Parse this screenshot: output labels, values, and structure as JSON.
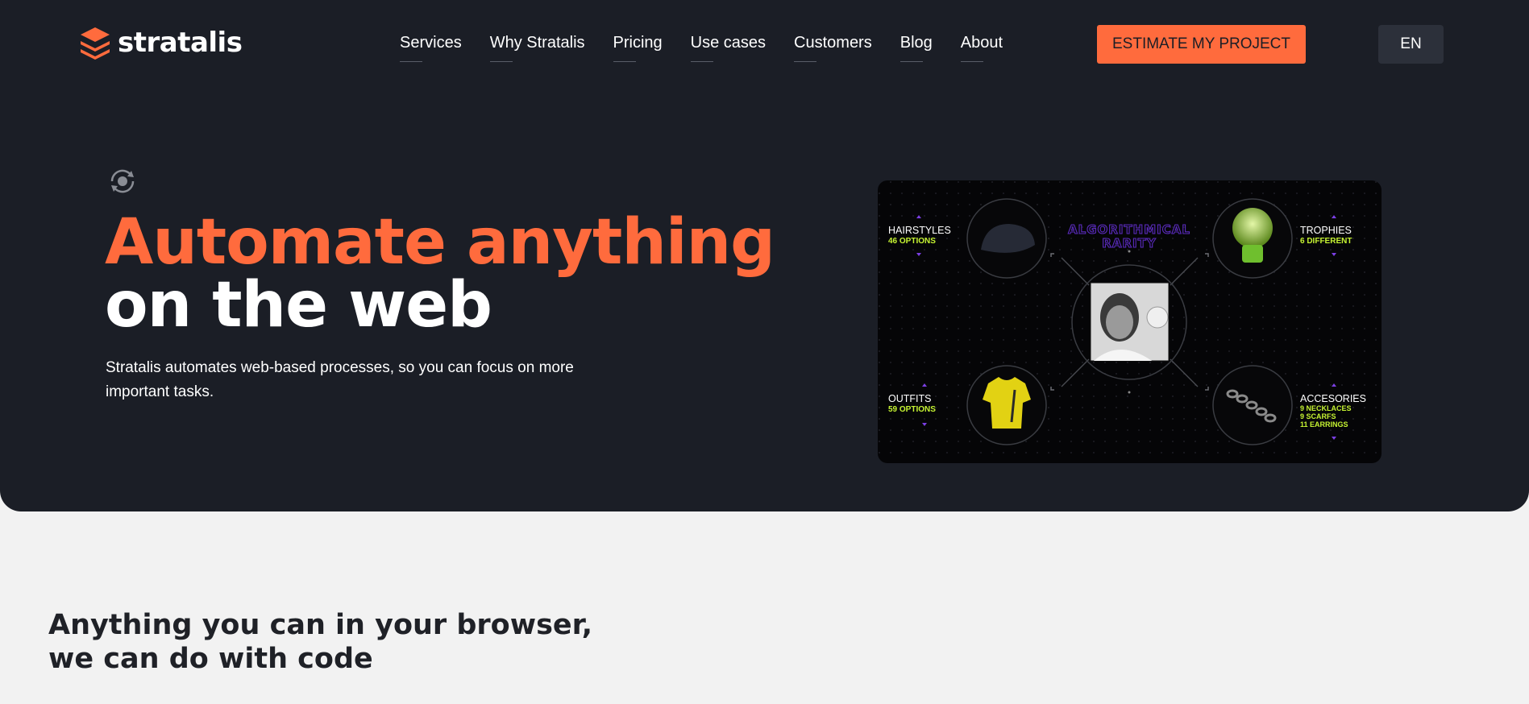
{
  "brand": {
    "name": "stratalis",
    "color": "#ff6b3d"
  },
  "nav": {
    "items": [
      "Services",
      "Why Stratalis",
      "Pricing",
      "Use cases",
      "Customers",
      "Blog",
      "About"
    ]
  },
  "header": {
    "cta_label": "ESTIMATE MY PROJECT",
    "lang_label": "EN"
  },
  "hero": {
    "icon": "refresh-icon",
    "title_line1": "Automate anything",
    "title_line2": "on the web",
    "lede": "Stratalis automates web-based processes, so you can focus on more important tasks."
  },
  "media": {
    "title": "ALGORITHMICAL RARITY",
    "hairstyles": {
      "label": "HAIRSTYLES",
      "value": "46 OPTIONS"
    },
    "trophies": {
      "label": "TROPHIES",
      "value": "6 DIFFERENT"
    },
    "outfits": {
      "label": "OUTFITS",
      "value": "59 OPTIONS"
    },
    "accessories": {
      "label": "ACCESORIES",
      "lines": [
        "9 NECKLACES",
        "9 SCARFS",
        "11 EARRINGS"
      ]
    }
  },
  "section": {
    "title_line1": "Anything you can in your browser,",
    "title_line2": "we can do with code"
  },
  "colors": {
    "accent": "#ff6b3d",
    "hero_bg": "#1b1e26",
    "page_bg": "#f2f2f2",
    "lime": "#c6f432",
    "purple": "#5b2bbf"
  }
}
